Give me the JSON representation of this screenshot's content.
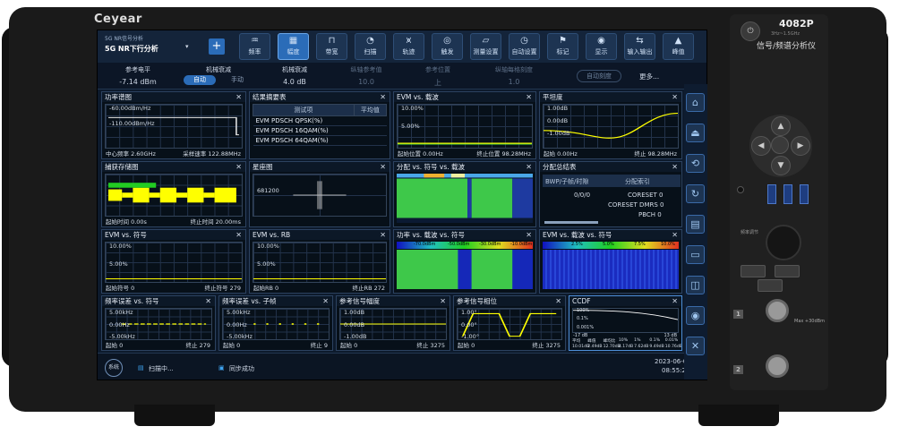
{
  "brand": "Ceyear",
  "model": "4082P",
  "model_sub": "信号/频谱分析仪",
  "model_tag": "3Hz~1.5GHz",
  "header": {
    "mode_small": "5G NR信号分析",
    "mode_main": "5G NR下行分析",
    "add_label": "+"
  },
  "toolbar": [
    {
      "label": "频率",
      "icon": "freq-icon"
    },
    {
      "label": "幅度",
      "icon": "amplitude-icon",
      "selected": true
    },
    {
      "label": "带宽",
      "icon": "bandwidth-icon"
    },
    {
      "label": "扫描",
      "icon": "sweep-icon"
    },
    {
      "label": "轨迹",
      "icon": "trace-icon"
    },
    {
      "label": "触发",
      "icon": "trigger-icon"
    },
    {
      "label": "测量设置",
      "icon": "meas-setup-icon"
    },
    {
      "label": "自动设置",
      "icon": "auto-setup-icon"
    },
    {
      "label": "标记",
      "icon": "marker-icon"
    },
    {
      "label": "显示",
      "icon": "display-icon"
    },
    {
      "label": "输入输出",
      "icon": "io-icon"
    },
    {
      "label": "峰值",
      "icon": "peak-icon"
    }
  ],
  "params": {
    "ref_level_label": "参考电平",
    "ref_level_value": "-7.14 dBm",
    "atten_label": "机械衰减",
    "atten_auto": "自动",
    "atten_manual": "手动",
    "atten2_label": "机械衰减",
    "atten2_value": "4.0 dB",
    "vert_ref_label": "纵轴参考值",
    "vert_ref_value": "10.0",
    "ref_pos_label": "参考位置",
    "ref_pos_value": "上",
    "vert_div_label": "纵轴每格刻度",
    "vert_div_value": "1.0",
    "autoscale_label": "自动刻度",
    "more_label": "更多..."
  },
  "windows": {
    "w1": {
      "title": "功率谱图",
      "y1": "-60.00dBm/Hz",
      "y2": "-110.00dBm/Hz",
      "f1": "中心频率 2.60GHz",
      "f2": "采样速率 122.88MHz"
    },
    "w2": {
      "title": "结果摘要表",
      "col1": "测试项",
      "col2": "平均值",
      "rows": [
        "EVM PDSCH QPSK(%)",
        "EVM PDSCH 16QAM(%)",
        "EVM PDSCH 64QAM(%)"
      ]
    },
    "w3": {
      "title": "EVM vs. 载波",
      "y1": "10.00%",
      "y2": "5.00%",
      "f1": "起始位置 0.00Hz",
      "f2": "终止位置 98.28MHz"
    },
    "w4": {
      "title": "平坦度",
      "y1": "1.00dB",
      "y2": "0.00dB",
      "y3": "-1.00dB",
      "f1": "起始 0.00Hz",
      "f2": "终止 98.28MHz"
    },
    "w5": {
      "title": "捕获存储图",
      "f1": "起始时间 0.00s",
      "f2": "终止时间 20.00ms"
    },
    "w6": {
      "title": "星座图",
      "v1": "681200"
    },
    "w7": {
      "title": "分配 vs. 符号 vs. 载波"
    },
    "w8": {
      "title": "分配总结表",
      "col1": "BWP/子帧/时隙",
      "col2": "分配索引",
      "r1a": "0/0/0",
      "r1b": "CORESET 0",
      "r2b": "CORESET DMRS 0",
      "r3b": "PBCH 0"
    },
    "w9": {
      "title": "EVM vs. 符号",
      "y1": "10.00%",
      "y2": "5.00%",
      "f1": "起始符号 0",
      "f2": "终止符号 279"
    },
    "w10": {
      "title": "EVM vs. RB",
      "y1": "10.00%",
      "y2": "5.00%",
      "f1": "起始RB 0",
      "f2": "终止RB 272"
    },
    "w11": {
      "title": "功率 vs. 载波 vs. 符号",
      "s1": "-70.0dBm",
      "s2": "-50.0dBm",
      "s3": "-30.0dBm",
      "s4": "-10.0dBm"
    },
    "w12": {
      "title": "EVM vs. 载波 vs. 符号",
      "s1": "2.5%",
      "s2": "5.0%",
      "s3": "7.5%",
      "s4": "10.0%"
    },
    "w13": {
      "title": "频率误差 vs. 符号",
      "y1": "5.00kHz",
      "y2": "0.00Hz",
      "y3": "-5.00kHz",
      "f1": "起始 0",
      "f2": "终止 279"
    },
    "w14": {
      "title": "频率误差 vs. 子帧",
      "y1": "5.00kHz",
      "y2": "0.00Hz",
      "y3": "-5.00kHz",
      "f1": "起始 0",
      "f2": "终止 9"
    },
    "w15": {
      "title": "参考信号幅度",
      "y1": "1.00dB",
      "y2": "0.00dB",
      "y3": "-1.00dB",
      "f1": "起始 0",
      "f2": "终止 3275"
    },
    "w16": {
      "title": "参考信号相位",
      "y1": "1.00°",
      "y2": "0.00°",
      "y3": "-1.00°",
      "f1": "起始 0",
      "f2": "终止 3275"
    },
    "w17": {
      "title": "CCDF",
      "p1": "100%",
      "p2": "0.1%",
      "p3": "0.001%",
      "x1": "-17 dB",
      "x2": "13 dB",
      "headers": [
        "平均",
        "峰值",
        "峰均比",
        "10%",
        "1%",
        "0.1%",
        "0.01%"
      ],
      "values": [
        "10.01dB",
        "2.49dB",
        "12.70dB",
        "4.17dB",
        "7.62dB",
        "9.49dB",
        "10.76dB"
      ]
    }
  },
  "status": {
    "system": "系统",
    "scan": "扫描中...",
    "sync": "同步成功",
    "date": "2023-06-05",
    "time": "08:55:27"
  },
  "front": {
    "knob_label": "频率调节",
    "input_label": "射频输入",
    "power_label": "⏻",
    "tag1": "1",
    "tag2": "2",
    "max_label": "Max +30dBm"
  }
}
